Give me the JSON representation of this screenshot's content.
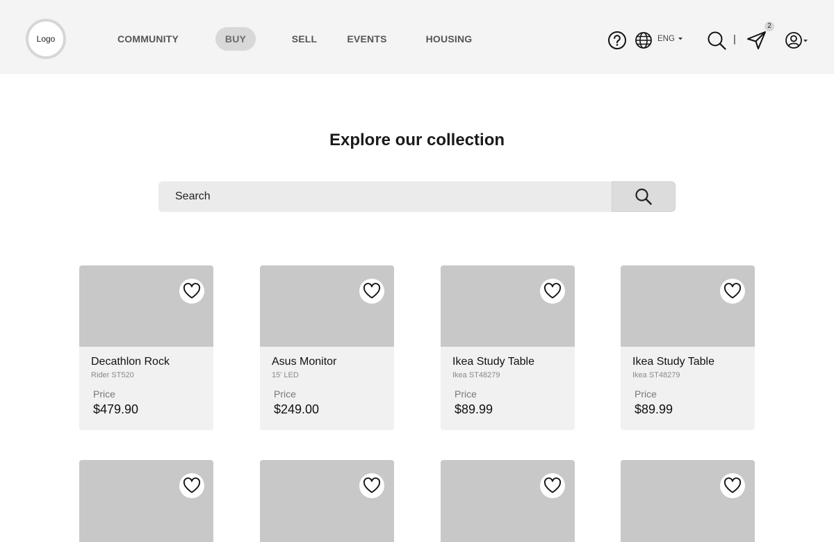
{
  "header": {
    "logo_text": "Logo",
    "nav": [
      {
        "label": "COMMUNITY"
      },
      {
        "label": "BUY",
        "active": true
      },
      {
        "label": "SELL"
      },
      {
        "label": "EVENTS"
      },
      {
        "label": "HOUSING"
      }
    ],
    "language": "ENG",
    "divider": "|",
    "notification_count": "2",
    "icons": [
      "help-icon",
      "globe-icon",
      "search-icon",
      "send-icon",
      "user-account-icon"
    ]
  },
  "main": {
    "title": "Explore our collection",
    "search": {
      "placeholder": "Search"
    },
    "products": [
      {
        "name": "Decathlon Rock",
        "subtitle": "Rider ST520",
        "price_label": "Price",
        "price": "$479.90"
      },
      {
        "name": "Asus Monitor",
        "subtitle": "15' LED",
        "price_label": "Price",
        "price": "$249.00"
      },
      {
        "name": "Ikea Study Table",
        "subtitle": "Ikea ST48279",
        "price_label": "Price",
        "price": "$89.99"
      },
      {
        "name": "Ikea Study Table",
        "subtitle": "Ikea ST48279",
        "price_label": "Price",
        "price": "$89.99"
      }
    ]
  },
  "colors": {
    "header_bg": "#f4f4f4",
    "active_pill": "#d8d8d8",
    "card_image": "#c8c8c8",
    "card_body": "#f1f1f1",
    "search_bg": "#ebebeb"
  }
}
